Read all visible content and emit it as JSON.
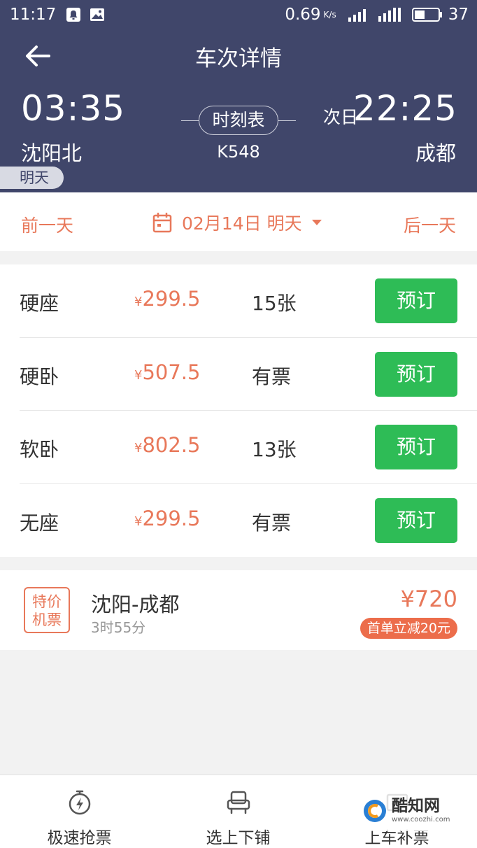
{
  "status_bar": {
    "time": "11:17",
    "speed": "0.69",
    "speed_unit": "K/s",
    "battery": "37"
  },
  "header": {
    "title": "车次详情",
    "departure": {
      "time": "03:35",
      "station": "沈阳北",
      "tag": "明天"
    },
    "arrival": {
      "next_day": "次日",
      "time": "22:25",
      "station": "成都"
    },
    "timetable_label": "时刻表",
    "train_no": "K548",
    "bg_color": "#40466a"
  },
  "date_bar": {
    "prev_label": "前一天",
    "next_label": "后一天",
    "date": "02月14日 明天",
    "accent_color": "#e8785a"
  },
  "seats": [
    {
      "name": "硬座",
      "currency": "¥",
      "price": "299.5",
      "availability": "15张",
      "button": "预订"
    },
    {
      "name": "硬卧",
      "currency": "¥",
      "price": "507.5",
      "availability": "有票",
      "button": "预订"
    },
    {
      "name": "软卧",
      "currency": "¥",
      "price": "802.5",
      "availability": "13张",
      "button": "预订"
    },
    {
      "name": "无座",
      "currency": "¥",
      "price": "299.5",
      "availability": "有票",
      "button": "预订"
    }
  ],
  "flight": {
    "badge_line1": "特价",
    "badge_line2": "机票",
    "route": "沈阳-成都",
    "duration": "3时55分",
    "price": "¥720",
    "promo": "首单立减20元"
  },
  "bottom_tabs": [
    {
      "label": "极速抢票",
      "icon": "stopwatch-lightning-icon"
    },
    {
      "label": "选上下铺",
      "icon": "seat-icon"
    },
    {
      "label": "上车补票",
      "icon": "ticket-icon"
    }
  ],
  "watermark": {
    "name": "酷知网",
    "url": "www.coozhi.com"
  },
  "colors": {
    "book_green": "#2ebc56",
    "price_orange": "#e8785a"
  }
}
